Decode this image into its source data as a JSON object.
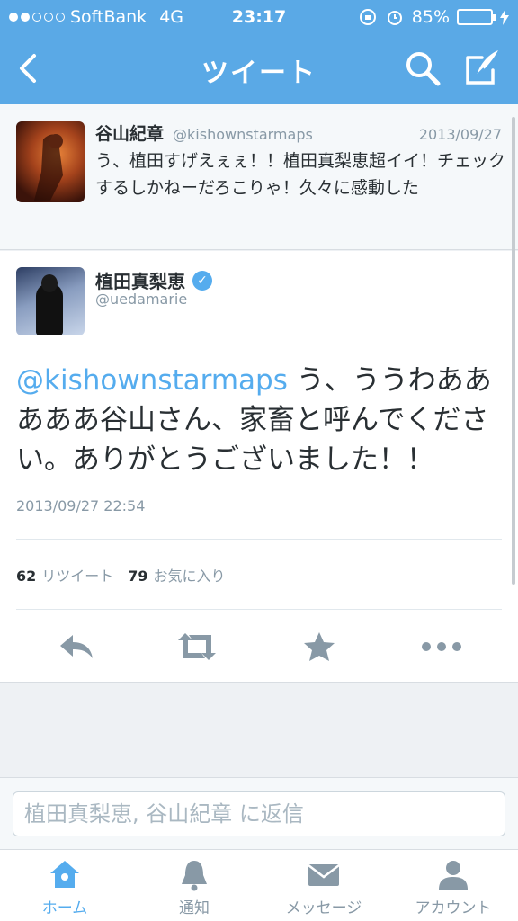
{
  "status": {
    "carrier": "SoftBank",
    "network": "4G",
    "time": "23:17",
    "battery": "85%"
  },
  "nav": {
    "title": "ツイート"
  },
  "parent_tweet": {
    "name": "谷山紀章",
    "handle": "@kishownstarmaps",
    "date": "2013/09/27",
    "text": "う、植田すげえぇぇ！！植田真梨恵超イイ！チェックするしかねーだろこりゃ！久々に感動した"
  },
  "main_tweet": {
    "name": "植田真梨恵",
    "handle": "@uedamarie",
    "mention": "@kishownstarmaps",
    "text": " う、ううわあああああ谷山さん、家畜と呼んでください。ありがとうございました！！",
    "timestamp": "2013/09/27 22:54",
    "retweet_count": "62",
    "retweet_label": "リツイート",
    "favorite_count": "79",
    "favorite_label": "お気に入り"
  },
  "reply": {
    "placeholder": "植田真梨恵, 谷山紀章 に返信"
  },
  "tabs": [
    {
      "label": "ホーム",
      "icon": "home-icon",
      "active": true
    },
    {
      "label": "通知",
      "icon": "bell-icon",
      "active": false
    },
    {
      "label": "メッセージ",
      "icon": "envelope-icon",
      "active": false
    },
    {
      "label": "アカウント",
      "icon": "person-icon",
      "active": false
    }
  ],
  "colors": {
    "brand": "#5aa9e6",
    "link": "#55acee",
    "muted": "#8899a6",
    "icon": "#8899a6"
  }
}
